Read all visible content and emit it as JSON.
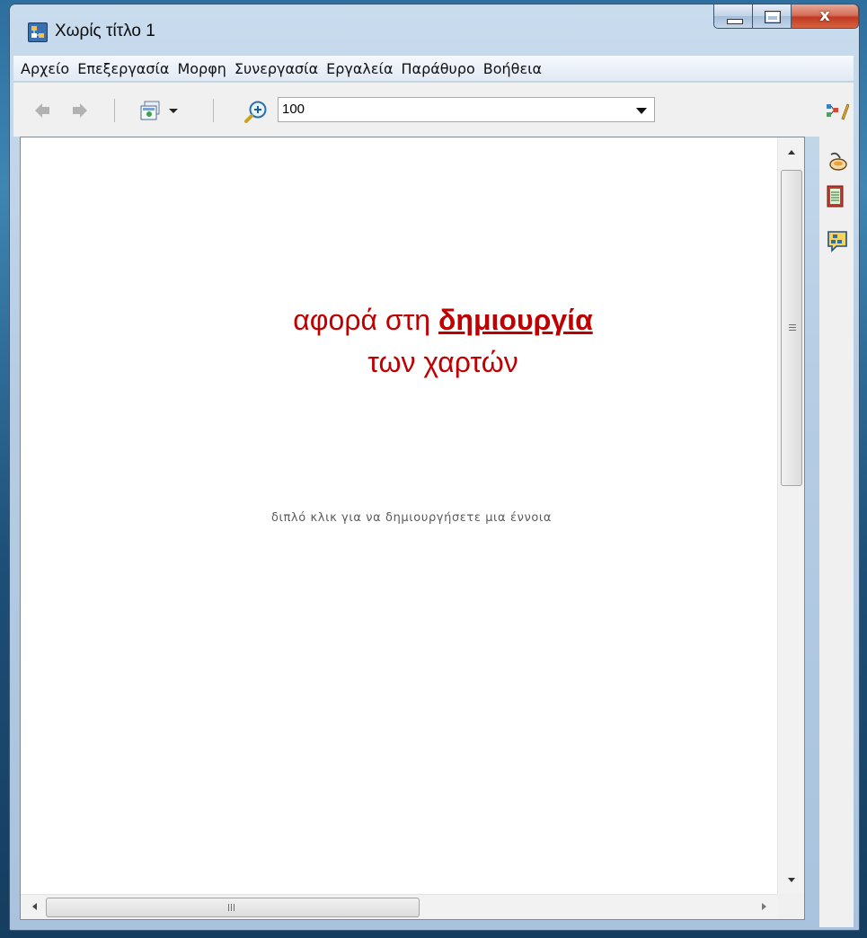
{
  "window": {
    "title": "Χωρίς τίτλο 1",
    "close_label": "x"
  },
  "menu": {
    "items": [
      "Αρχείο",
      "Επεξεργασία",
      "Μορφη",
      "Συνεργασία",
      "Εργαλεία",
      "Παράθυρο",
      "Βοήθεια"
    ]
  },
  "toolbar": {
    "zoom_value": "100",
    "icons": [
      "back-arrow-icon",
      "forward-arrow-icon",
      "map-view-icon",
      "zoom-in-icon"
    ]
  },
  "right_panel": {
    "icons": [
      "styles-icon",
      "paint-bucket-icon",
      "outline-icon",
      "concept-map-icon"
    ]
  },
  "canvas": {
    "overlay_line1_prefix": "αφορά στη ",
    "overlay_line1_emphasis": "δημιουργία ",
    "overlay_line2": "των χαρτών",
    "hint": "διπλό κλικ για να δημιουργήσετε μια έννοια",
    "overlay_color": "#c00000"
  }
}
